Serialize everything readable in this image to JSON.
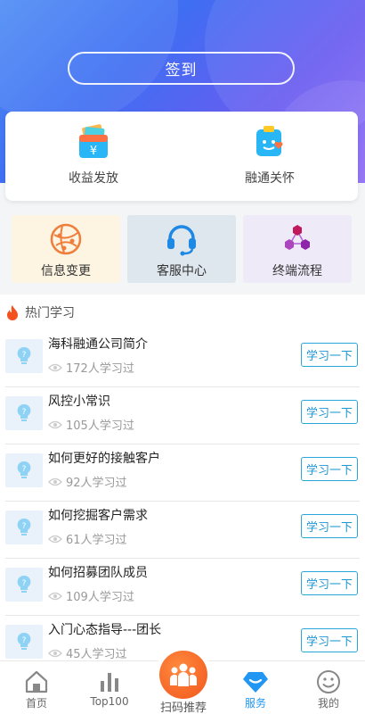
{
  "header": {
    "signin_label": "签到"
  },
  "quick_card": {
    "items": [
      {
        "label": "收益发放",
        "icon": "wallet-yen-icon"
      },
      {
        "label": "融通关怀",
        "icon": "clipboard-heart-icon"
      }
    ]
  },
  "tiles": [
    {
      "label": "信息变更",
      "icon": "globe-network-icon",
      "bg": "#fdf4e1"
    },
    {
      "label": "客服中心",
      "icon": "headset-icon",
      "bg": "#dfe7ee"
    },
    {
      "label": "终端流程",
      "icon": "hexagon-nodes-icon",
      "bg": "#eeeaf8"
    }
  ],
  "hot_study": {
    "title": "热门学习",
    "button_label": "学习一下",
    "items": [
      {
        "title": "海科融通公司简介",
        "count": "172人学习过"
      },
      {
        "title": "风控小常识",
        "count": "105人学习过"
      },
      {
        "title": "如何更好的接触客户",
        "count": "92人学习过"
      },
      {
        "title": "如何挖掘客户需求",
        "count": "61人学习过"
      },
      {
        "title": "如何招募团队成员",
        "count": "109人学习过"
      },
      {
        "title": "入门心态指导---团长",
        "count": "45人学习过"
      }
    ]
  },
  "tabbar": {
    "tabs": [
      {
        "label": "首页"
      },
      {
        "label": "Top100"
      },
      {
        "label": "扫码推荐"
      },
      {
        "label": "服务"
      },
      {
        "label": "我的"
      }
    ],
    "active_color": "#2196f3"
  }
}
